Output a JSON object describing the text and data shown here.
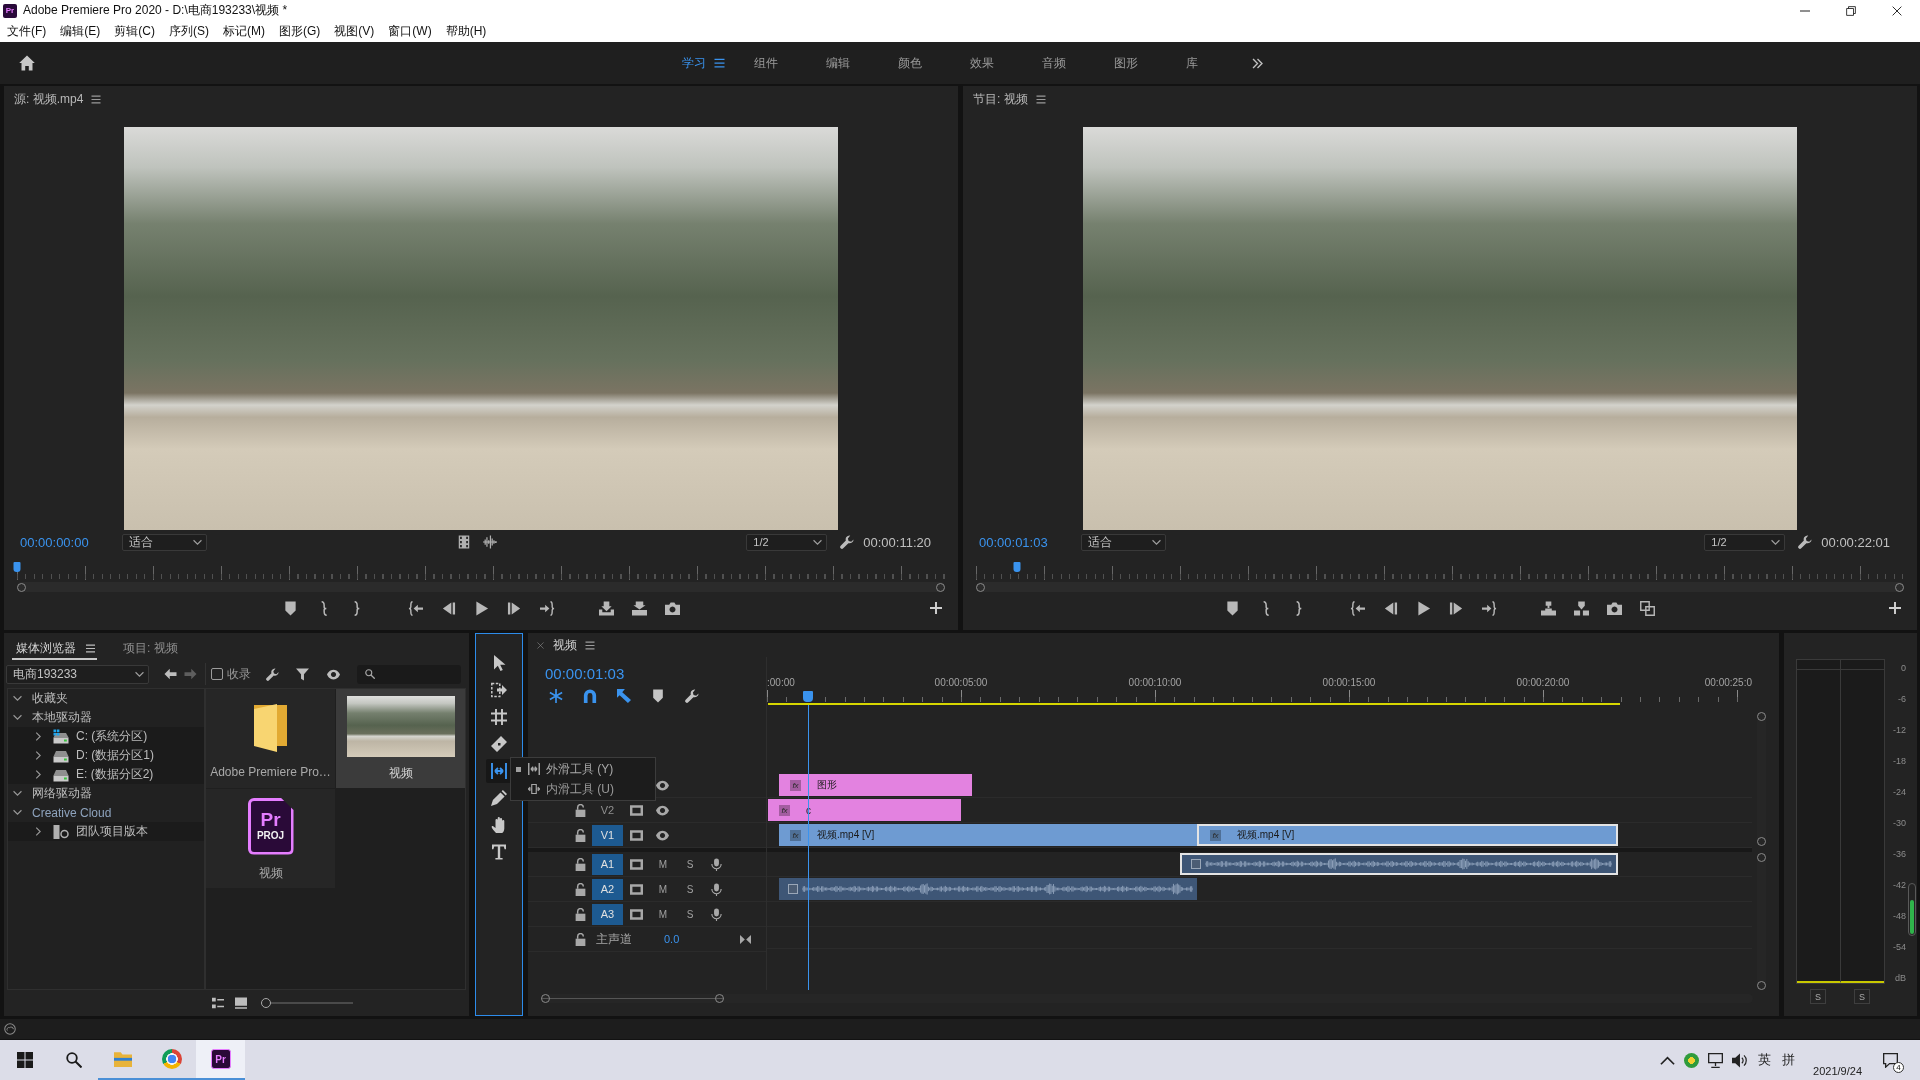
{
  "window": {
    "logo": "Pr",
    "title": "Adobe Premiere Pro 2020 - D:\\电商193233\\视频 *"
  },
  "menu": [
    "文件(F)",
    "编辑(E)",
    "剪辑(C)",
    "序列(S)",
    "标记(M)",
    "图形(G)",
    "视图(V)",
    "窗口(W)",
    "帮助(H)"
  ],
  "workspaces": [
    {
      "label": "学习",
      "selected": true
    },
    {
      "label": "组件",
      "selected": false
    },
    {
      "label": "编辑",
      "selected": false
    },
    {
      "label": "颜色",
      "selected": false
    },
    {
      "label": "效果",
      "selected": false
    },
    {
      "label": "音频",
      "selected": false
    },
    {
      "label": "图形",
      "selected": false
    },
    {
      "label": "库",
      "selected": false
    }
  ],
  "source_monitor": {
    "title": "源: 视频.mp4",
    "timecode": "00:00:00:00",
    "zoom": "适合",
    "resolution": "1/2",
    "duration": "00:00:11:20",
    "playhead": {
      "level": 0
    }
  },
  "program_monitor": {
    "title": "节目: 视频",
    "timecode": "00:00:01:03",
    "zoom": "适合",
    "resolution": "1/2",
    "duration": "00:00:22:01",
    "playhead": {
      "level": 0.044
    }
  },
  "media_browser": {
    "tabs": [
      {
        "label": "媒体浏览器",
        "selected": true
      },
      {
        "label": "项目: 视频",
        "selected": false
      }
    ],
    "location": "电商193233",
    "ingest": {
      "label": "收录",
      "checked": false
    },
    "tree": [
      {
        "label": "收藏夹",
        "kind": "group",
        "expanded": true
      },
      {
        "label": "本地驱动器",
        "kind": "group",
        "expanded": true,
        "children": [
          {
            "label": "C: (系统分区)",
            "kind": "system_drive",
            "expanded": false
          },
          {
            "label": "D: (数据分区1)",
            "kind": "drive",
            "expanded": false
          },
          {
            "label": "E: (数据分区2)",
            "kind": "drive",
            "expanded": false
          }
        ]
      },
      {
        "label": "网络驱动器",
        "kind": "group",
        "expanded": true
      },
      {
        "label": "Creative Cloud",
        "kind": "cloud",
        "expanded": true,
        "children": [
          {
            "label": "团队项目版本",
            "kind": "team_project",
            "expanded": false
          }
        ]
      }
    ],
    "items": [
      {
        "label": "Adobe Premiere Pro…",
        "kind": "folder",
        "selected": false
      },
      {
        "label": "视频",
        "kind": "video",
        "selected": true
      },
      {
        "label": "视频",
        "kind": "project",
        "logo": "Pr",
        "caption": "PROJ",
        "selected": false
      }
    ],
    "zoom": {
      "level": 0
    }
  },
  "tools": {
    "focused": true,
    "items": [
      {
        "kind": "selection",
        "selected": false
      },
      {
        "kind": "track_select",
        "selected": false
      },
      {
        "kind": "ripple",
        "selected": false
      },
      {
        "kind": "razor",
        "selected": false
      },
      {
        "kind": "slip",
        "selected": true
      },
      {
        "kind": "pen",
        "selected": false
      },
      {
        "kind": "hand",
        "selected": false
      },
      {
        "kind": "type",
        "selected": false
      }
    ]
  },
  "tool_flyout": [
    {
      "label": "外滑工具 (Y)",
      "kind": "slip",
      "selected": true
    },
    {
      "label": "内滑工具 (U)",
      "kind": "slide",
      "selected": false
    }
  ],
  "timeline": {
    "title": "视频",
    "timecode": "00:00:01:03",
    "toggles": [
      {
        "kind": "nest",
        "on": true
      },
      {
        "kind": "snap",
        "on": true
      },
      {
        "kind": "linked",
        "on": true
      }
    ],
    "ruler": [
      ":00:00",
      "00:00:05:00",
      "00:00:10:00",
      "00:00:15:00",
      "00:00:20:00",
      "00:00:25:0"
    ],
    "playhead": {
      "level": 0.042
    },
    "tracks": [
      {
        "kind": "video",
        "clips": [
          {
            "label": "图形",
            "badge": "fx",
            "color": "#e382e0",
            "selected": false
          }
        ]
      },
      {
        "kind": "video",
        "label": "V2",
        "targeted": false,
        "clips": [
          {
            "label": "c",
            "badge": "fx",
            "color": "#e382e0",
            "selected": false
          }
        ]
      },
      {
        "kind": "video",
        "label": "V1",
        "targeted": true,
        "clips": [
          {
            "label": "视频.mp4 [V]",
            "badge": "fx",
            "color": "#6e9bd2",
            "selected": false
          },
          {
            "label": "视频.mp4 [V]",
            "badge": "fx",
            "color": "#6e9bd2",
            "selected": true
          }
        ]
      },
      {
        "kind": "audio",
        "label": "A1",
        "targeted": true,
        "mute": "M",
        "solo": "S",
        "clips": [
          {
            "color": "#3e5676",
            "selected": true
          }
        ]
      },
      {
        "kind": "audio",
        "label": "A2",
        "targeted": true,
        "mute": "M",
        "solo": "S",
        "clips": [
          {
            "color": "#3e5676",
            "selected": false
          }
        ]
      },
      {
        "kind": "audio",
        "label": "A3",
        "targeted": true,
        "mute": "M",
        "solo": "S"
      }
    ],
    "master": {
      "label": "主声道",
      "value": "0.0"
    }
  },
  "audio_meter": {
    "scale": [
      "0",
      "-6",
      "-12",
      "-18",
      "-24",
      "-30",
      "-36",
      "-42",
      "-48",
      "-54",
      "dB"
    ],
    "solo": [
      "S",
      "S"
    ],
    "level": 0.7
  },
  "taskbar": {
    "apps": [
      {
        "kind": "explorer",
        "running": true,
        "selected": false
      },
      {
        "kind": "browser",
        "running": true,
        "selected": false
      },
      {
        "kind": "premiere",
        "logo": "Pr",
        "running": true,
        "selected": true
      }
    ],
    "ime_mode": "英",
    "ime_layout": "拼",
    "date": "2021/9/24",
    "notifications": "4"
  }
}
